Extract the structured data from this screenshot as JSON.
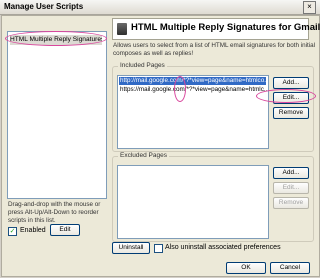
{
  "window": {
    "title": "Manage User Scripts",
    "close_glyph": "×"
  },
  "scripts": {
    "items": [
      "HTML Multiple Reply Signatures fo..."
    ],
    "hint": "Drag-and-drop with the mouse or press Alt-Up/Alt-Down to reorder scripts in this list.",
    "enabled_label": "Enabled",
    "enabled_checked": true,
    "edit_label": "Edit"
  },
  "detail": {
    "title": "HTML Multiple Reply Signatures for Gmail",
    "description": "Allows users to select from a list of HTML email signatures for both initial composes as well as replies!"
  },
  "included": {
    "title": "Included Pages",
    "rows": [
      "http://mail.google.com/*?*view=page&name=htmlco...",
      "https://mail.google.com/*?*view=page&name=htmlc..."
    ],
    "add_label": "Add...",
    "edit_label": "Edit...",
    "remove_label": "Remove"
  },
  "excluded": {
    "title": "Excluded Pages",
    "rows": [],
    "add_label": "Add...",
    "edit_label": "Edit...",
    "remove_label": "Remove"
  },
  "footer": {
    "uninstall_label": "Uninstall",
    "also_uninstall_label": "Also uninstall associated preferences",
    "also_uninstall_checked": false,
    "ok_label": "OK",
    "cancel_label": "Cancel"
  },
  "colors": {
    "annotation": "#d9479d",
    "selection": "#316ac5"
  }
}
